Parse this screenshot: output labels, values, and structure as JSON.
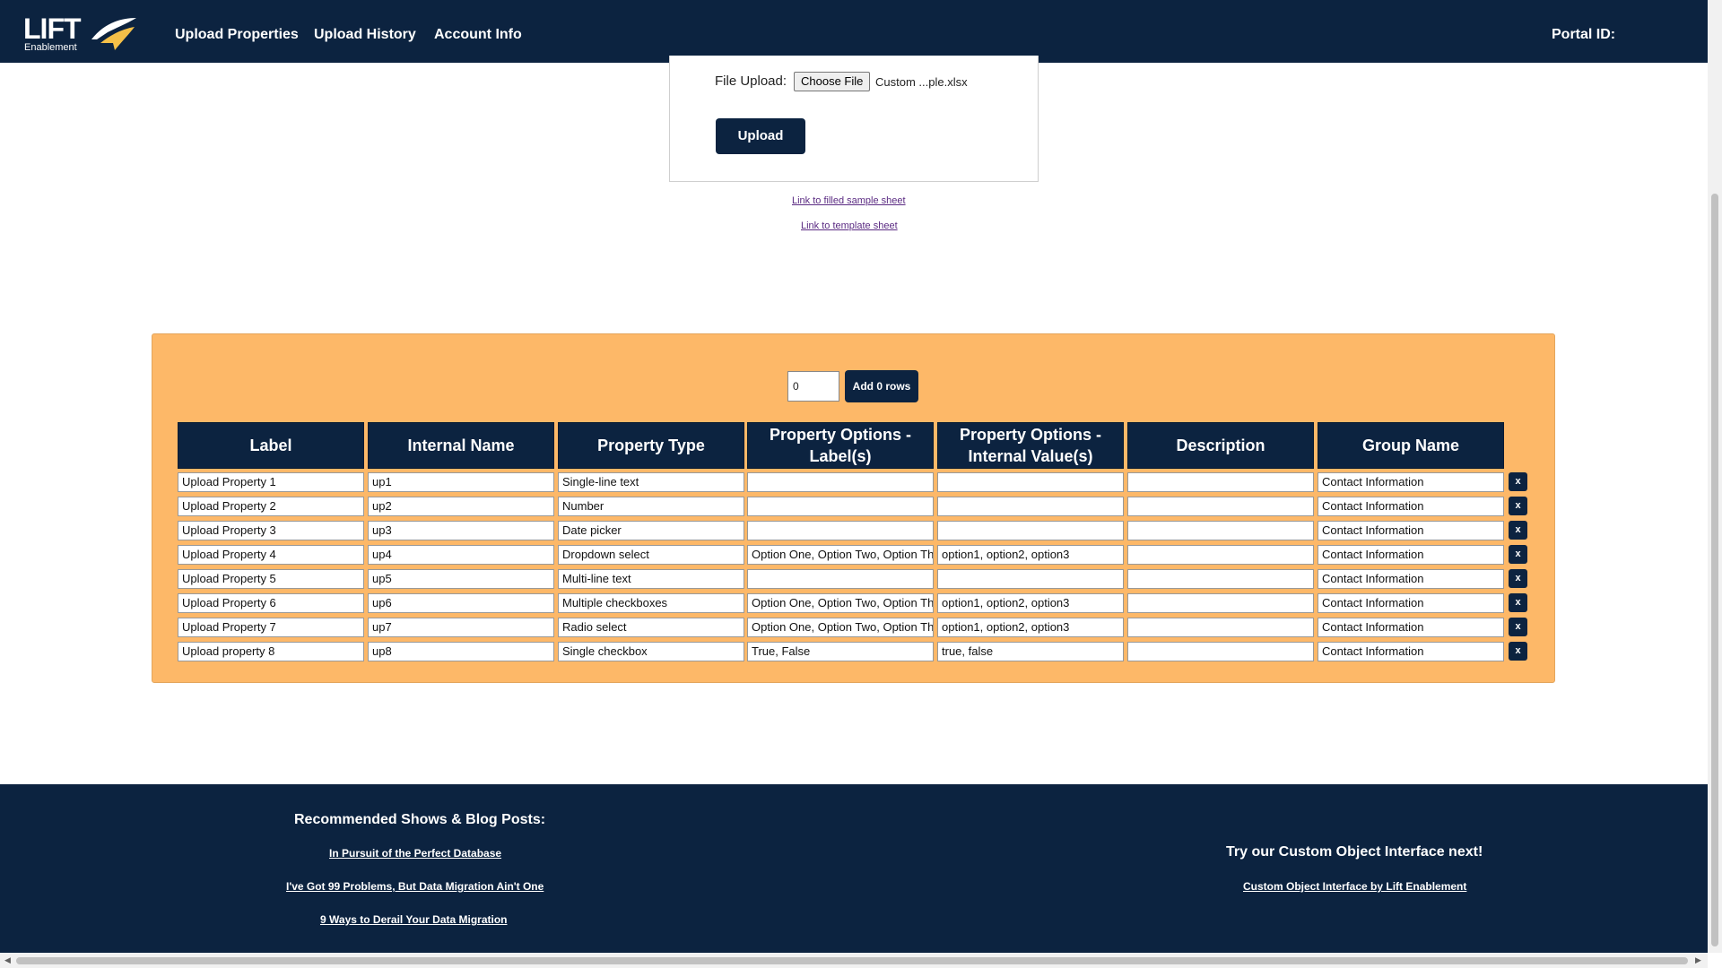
{
  "nav": {
    "logo_text": "LIFT",
    "logo_subtext": "Enablement",
    "links": [
      "Upload Properties",
      "Upload History",
      "Account Info"
    ],
    "portal_label": "Portal ID:"
  },
  "upload": {
    "label": "File Upload:",
    "choose_button": "Choose File",
    "file_name": "Custom ...ple.xlsx",
    "upload_button": "Upload"
  },
  "links": {
    "sample": "Link to filled sample sheet",
    "template": "Link to template sheet"
  },
  "table": {
    "rows_input_value": "0",
    "add_button": "Add 0 rows",
    "headers": [
      "Label",
      "Internal Name",
      "Property Type",
      "Property Options - Label(s)",
      "Property Options - Internal Value(s)",
      "Description",
      "Group Name"
    ],
    "delete_label": "x",
    "rows": [
      [
        "Upload Property 1",
        "up1",
        "Single-line text",
        "",
        "",
        "",
        "Contact Information"
      ],
      [
        "Upload Property 2",
        "up2",
        "Number",
        "",
        "",
        "",
        "Contact Information"
      ],
      [
        "Upload Property 3",
        "up3",
        "Date picker",
        "",
        "",
        "",
        "Contact Information"
      ],
      [
        "Upload Property 4",
        "up4",
        "Dropdown select",
        "Option One, Option Two, Option Three",
        "option1, option2, option3",
        "",
        "Contact Information"
      ],
      [
        "Upload Property 5",
        "up5",
        "Multi-line text",
        "",
        "",
        "",
        "Contact Information"
      ],
      [
        "Upload Property 6",
        "up6",
        "Multiple checkboxes",
        "Option One, Option Two, Option Three",
        "option1, option2, option3",
        "",
        "Contact Information"
      ],
      [
        "Upload Property 7",
        "up7",
        "Radio select",
        "Option One, Option Two, Option Three",
        "option1, option2, option3",
        "",
        "Contact Information"
      ],
      [
        "Upload property 8",
        "up8",
        "Single checkbox",
        "True, False",
        "true, false",
        "",
        "Contact Information"
      ]
    ]
  },
  "footer": {
    "left_heading": "Recommended Shows & Blog Posts:",
    "left_links": [
      "In Pursuit of the Perfect Database",
      "I've Got 99 Problems, But Data Migration Ain't One",
      "9 Ways to Derail Your Data Migration"
    ],
    "right_heading": "Try our Custom Object Interface next!",
    "right_link": "Custom Object Interface by Lift Enablement"
  },
  "colors": {
    "navy": "#0c2340",
    "panel_orange": "#fdb868",
    "link_purple": "#5a2a82"
  }
}
